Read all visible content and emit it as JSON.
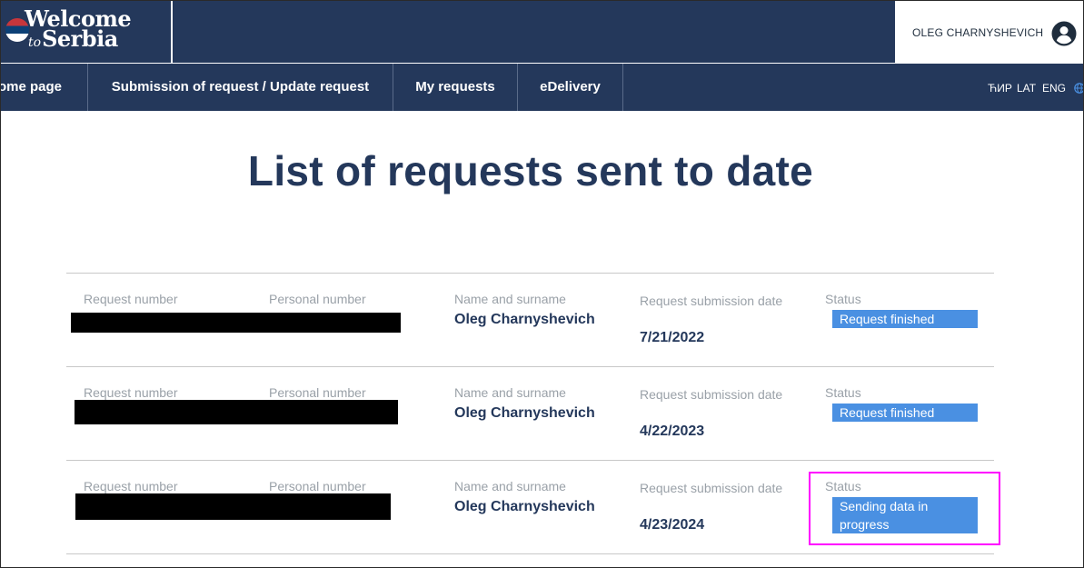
{
  "logo": {
    "line1": "Welcome",
    "line2_small": "to",
    "line2_big": "Serbia"
  },
  "user": {
    "name": "OLEG CHARNYSHEVICH",
    "icon": "account-circle-icon"
  },
  "nav": {
    "home": "ome page",
    "submission": "Submission of request / Update request",
    "my_requests": "My requests",
    "edelivery": "eDelivery"
  },
  "languages": {
    "cyr": "ЋИР",
    "lat": "LAT",
    "eng": "ENG",
    "icon": "globe-icon"
  },
  "page": {
    "title": "List of requests sent to date"
  },
  "labels": {
    "request_number": "Request number",
    "personal_number": "Personal number",
    "name_surname": "Name and surname",
    "submission_date": "Request submission date",
    "status": "Status"
  },
  "requests": [
    {
      "name": "Oleg Charnyshevich",
      "date": "7/21/2022",
      "status": "Request finished"
    },
    {
      "name": "Oleg Charnyshevich",
      "date": "4/22/2023",
      "status": "Request finished"
    },
    {
      "name": "Oleg Charnyshevich",
      "date": "4/23/2024",
      "status": "Sending data in progress"
    }
  ],
  "colors": {
    "navy": "#24385b",
    "status_blue": "#4a90e2",
    "highlight": "#ff00ff"
  }
}
